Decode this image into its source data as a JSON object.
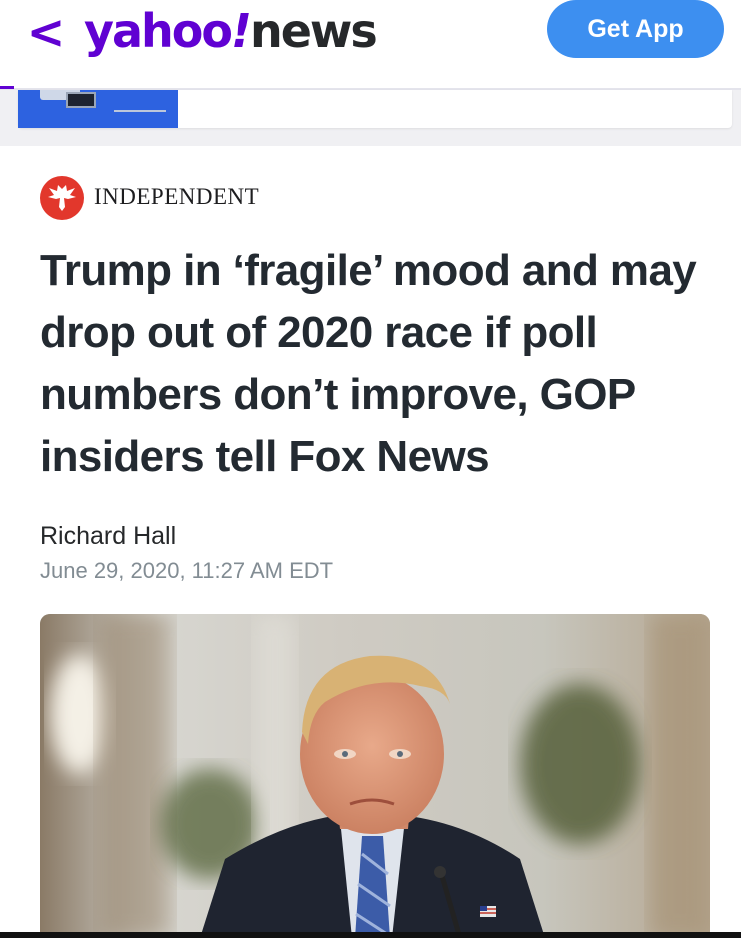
{
  "header": {
    "back_label": "<",
    "logo_brand": "yahoo",
    "logo_exclamation": "!",
    "logo_section": "news",
    "get_app_label": "Get App"
  },
  "ad": {
    "icon": "tablet-device-icon"
  },
  "article": {
    "source_icon": "independent-eagle-icon",
    "source_name": "Independent",
    "headline": "Trump in ‘fragile’ mood and may drop out of 2020 race if poll numbers don’t improve, GOP insiders tell Fox News",
    "author": "Richard Hall",
    "timestamp": "June 29, 2020, 11:27 AM EDT"
  },
  "colors": {
    "brand_purple": "#6001d2",
    "get_app_blue": "#3d8ff0",
    "source_red": "#e2372c",
    "headline_text": "#232a31",
    "timestamp_gray": "#828c93"
  }
}
